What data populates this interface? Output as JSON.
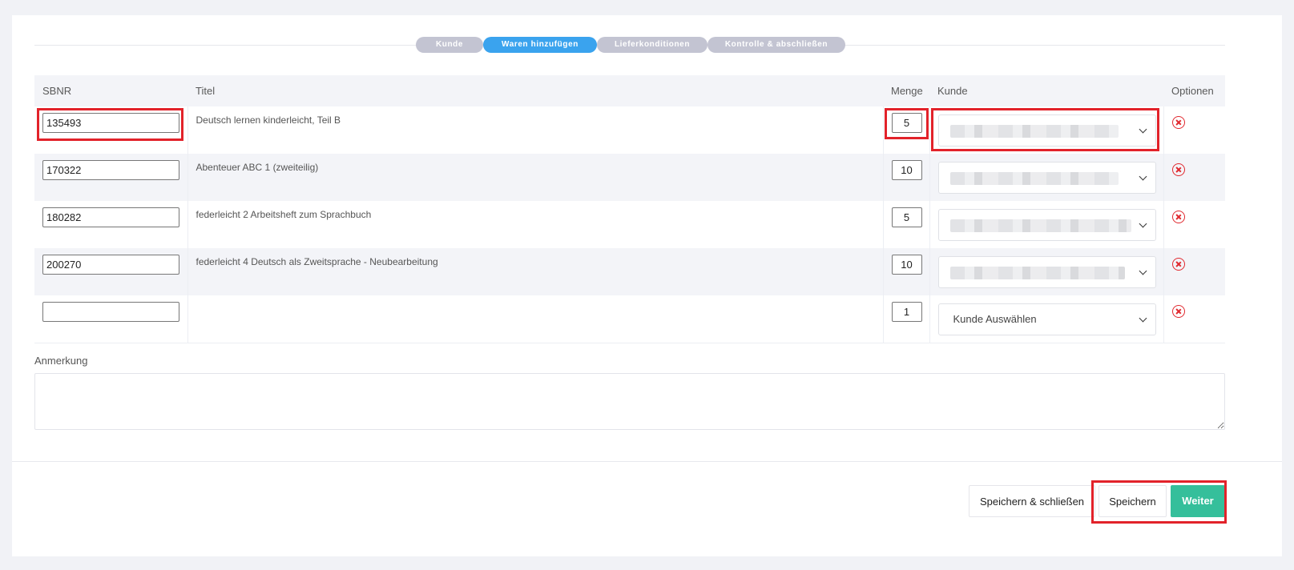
{
  "stepper": {
    "steps": [
      "Kunde",
      "Waren hinzufügen",
      "Lieferkonditionen",
      "Kontrolle & abschließen"
    ],
    "active_index": 1
  },
  "table": {
    "headers": {
      "sbnr": "SBNR",
      "titel": "Titel",
      "menge": "Menge",
      "kunde": "Kunde",
      "optionen": "Optionen"
    },
    "rows": [
      {
        "sbnr": "135493",
        "titel": "Deutsch lernen kinderleicht, Teil B",
        "menge": "5",
        "kunde": ""
      },
      {
        "sbnr": "170322",
        "titel": "Abenteuer ABC 1 (zweiteilig)",
        "menge": "10",
        "kunde": ""
      },
      {
        "sbnr": "180282",
        "titel": "federleicht 2 Arbeitsheft zum Sprachbuch",
        "menge": "5",
        "kunde": ""
      },
      {
        "sbnr": "200270",
        "titel": "federleicht 4 Deutsch als Zweitsprache - Neubearbeitung",
        "menge": "10",
        "kunde": ""
      },
      {
        "sbnr": "",
        "titel": "",
        "menge": "1",
        "kunde": "Kunde Auswählen"
      }
    ]
  },
  "remark": {
    "label": "Anmerkung",
    "value": ""
  },
  "buttons": {
    "save_close": "Speichern & schließen",
    "save": "Speichern",
    "next": "Weiter"
  },
  "icons": {
    "remove": "remove-circle-x-icon",
    "dropdown": "chevron-down-icon"
  },
  "colors": {
    "active_step": "#3aa3ee",
    "inactive_step": "#c3c4d2",
    "next_button": "#35bf9b",
    "remove_icon": "#e0282e",
    "highlight": "#e2222a"
  }
}
